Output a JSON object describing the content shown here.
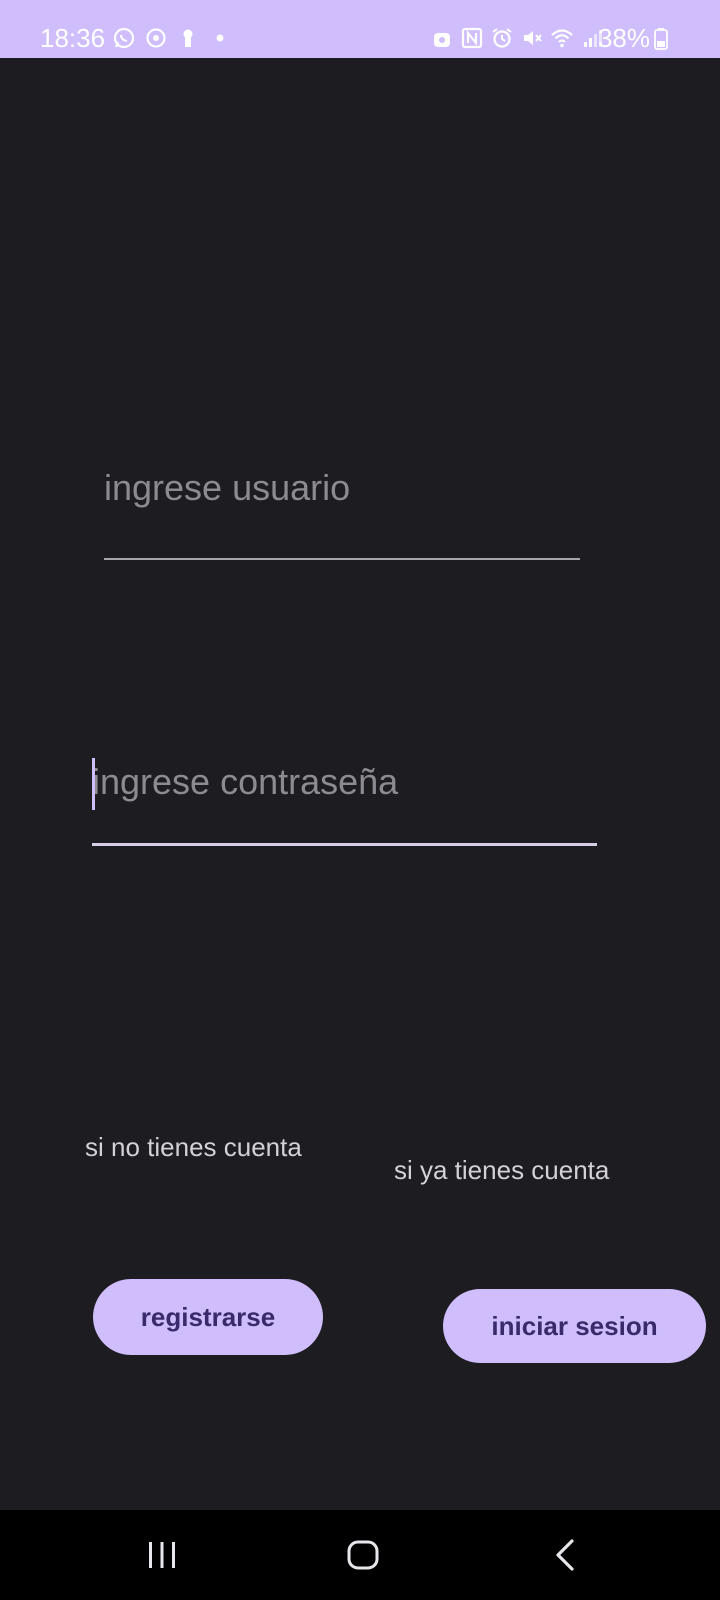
{
  "status_bar": {
    "time": "18:36",
    "battery": "38%",
    "left_icons": [
      "whatsapp-icon",
      "sync-icon",
      "keyhole-icon",
      "dot-icon"
    ],
    "right_icons": [
      "vpn-icon",
      "nfc-icon",
      "alarm-icon",
      "mute-icon",
      "wifi-icon",
      "signal-icon",
      "battery-icon"
    ],
    "background": "#cfbdfc"
  },
  "login": {
    "username_placeholder": "ingrese usuario",
    "password_placeholder": "ingrese contraseña",
    "register_hint": "si no tienes cuenta",
    "login_hint": "si ya tienes cuenta",
    "register_button": "registrarse",
    "login_button": "iniciar sesion"
  },
  "colors": {
    "background": "#1d1c21",
    "accent": "#cfbdfc",
    "button_text": "#3a2a6b"
  },
  "nav_bar": {
    "buttons": [
      "recents-icon",
      "home-icon",
      "back-icon"
    ]
  }
}
